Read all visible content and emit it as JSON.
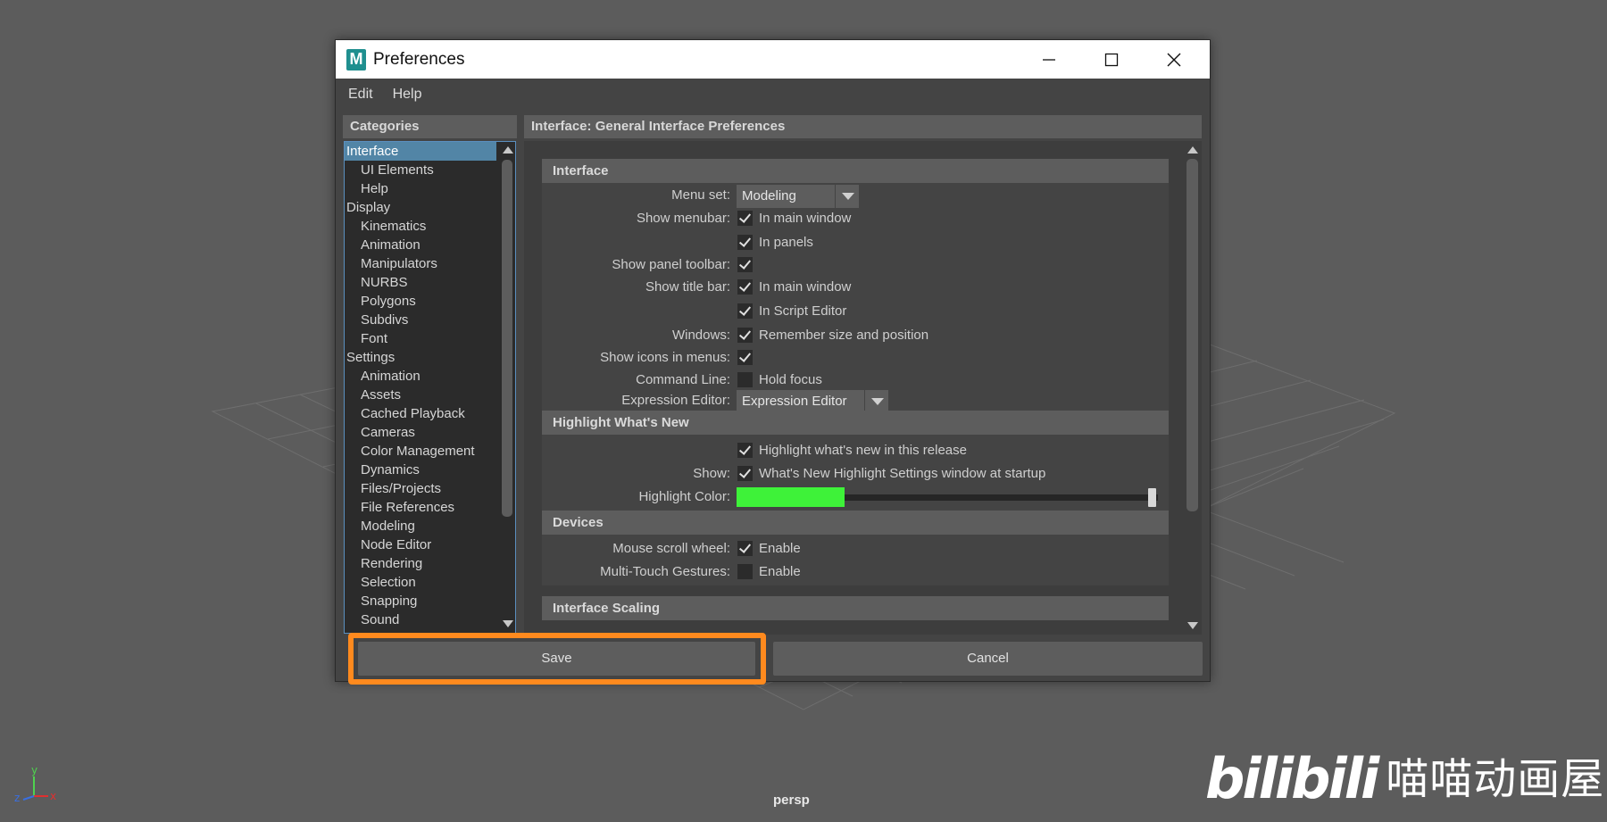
{
  "viewport": {
    "camera_label": "persp",
    "axis": {
      "x": "x",
      "y": "y",
      "z": "z"
    },
    "watermark_logo": "bilibili",
    "watermark_name": "喵喵动画屋"
  },
  "dialog": {
    "title": "Preferences",
    "app_icon_letter": "M",
    "menu": [
      "Edit",
      "Help"
    ],
    "categories_header": "Categories",
    "categories": [
      {
        "label": "Interface",
        "level": 0,
        "selected": true
      },
      {
        "label": "UI Elements",
        "level": 1
      },
      {
        "label": "Help",
        "level": 1
      },
      {
        "label": "Display",
        "level": 0
      },
      {
        "label": "Kinematics",
        "level": 1
      },
      {
        "label": "Animation",
        "level": 1
      },
      {
        "label": "Manipulators",
        "level": 1
      },
      {
        "label": "NURBS",
        "level": 1
      },
      {
        "label": "Polygons",
        "level": 1
      },
      {
        "label": "Subdivs",
        "level": 1
      },
      {
        "label": "Font",
        "level": 1
      },
      {
        "label": "Settings",
        "level": 0
      },
      {
        "label": "Animation",
        "level": 1
      },
      {
        "label": "Assets",
        "level": 1
      },
      {
        "label": "Cached Playback",
        "level": 1
      },
      {
        "label": "Cameras",
        "level": 1
      },
      {
        "label": "Color Management",
        "level": 1
      },
      {
        "label": "Dynamics",
        "level": 1
      },
      {
        "label": "Files/Projects",
        "level": 1
      },
      {
        "label": "File References",
        "level": 1
      },
      {
        "label": "Modeling",
        "level": 1
      },
      {
        "label": "Node Editor",
        "level": 1
      },
      {
        "label": "Rendering",
        "level": 1
      },
      {
        "label": "Selection",
        "level": 1
      },
      {
        "label": "Snapping",
        "level": 1
      },
      {
        "label": "Sound",
        "level": 1
      }
    ],
    "main_header": "Interface: General Interface Preferences",
    "sections": {
      "interface": {
        "title": "Interface",
        "menu_set_label": "Menu set:",
        "menu_set_value": "Modeling",
        "show_menubar_label": "Show menubar:",
        "show_menubar_main": "In main window",
        "show_menubar_panels": "In panels",
        "show_panel_toolbar_label": "Show panel toolbar:",
        "show_title_bar_label": "Show title bar:",
        "show_title_bar_main": "In main window",
        "show_title_bar_script": "In Script Editor",
        "windows_label": "Windows:",
        "windows_option": "Remember size and position",
        "show_icons_label": "Show icons in menus:",
        "command_line_label": "Command Line:",
        "command_line_option": "Hold focus",
        "expression_editor_label": "Expression Editor:",
        "expression_editor_value": "Expression Editor"
      },
      "highlight": {
        "title": "Highlight What's New",
        "highlight_option": "Highlight what's new in this release",
        "show_label": "Show:",
        "show_option": "What's New Highlight Settings window at startup",
        "color_label": "Highlight Color:",
        "color_value": "#3ef239",
        "slider_level": 1.0
      },
      "devices": {
        "title": "Devices",
        "mouse_scroll_label": "Mouse scroll wheel:",
        "mouse_scroll_option": "Enable",
        "multitouch_label": "Multi-Touch Gestures:",
        "multitouch_option": "Enable"
      },
      "scaling": {
        "title": "Interface Scaling"
      }
    },
    "checkboxes": {
      "menubar_main": true,
      "menubar_panels": true,
      "panel_toolbar": true,
      "titlebar_main": true,
      "titlebar_script": true,
      "windows_remember": true,
      "icons_in_menus": true,
      "command_line_hold": false,
      "highlight_new": true,
      "whats_new_startup": true,
      "mouse_scroll": true,
      "multitouch": false
    },
    "buttons": {
      "save": "Save",
      "cancel": "Cancel"
    },
    "colors": {
      "highlight_outline": "#ff8a1e",
      "selection": "#5285a6"
    }
  }
}
